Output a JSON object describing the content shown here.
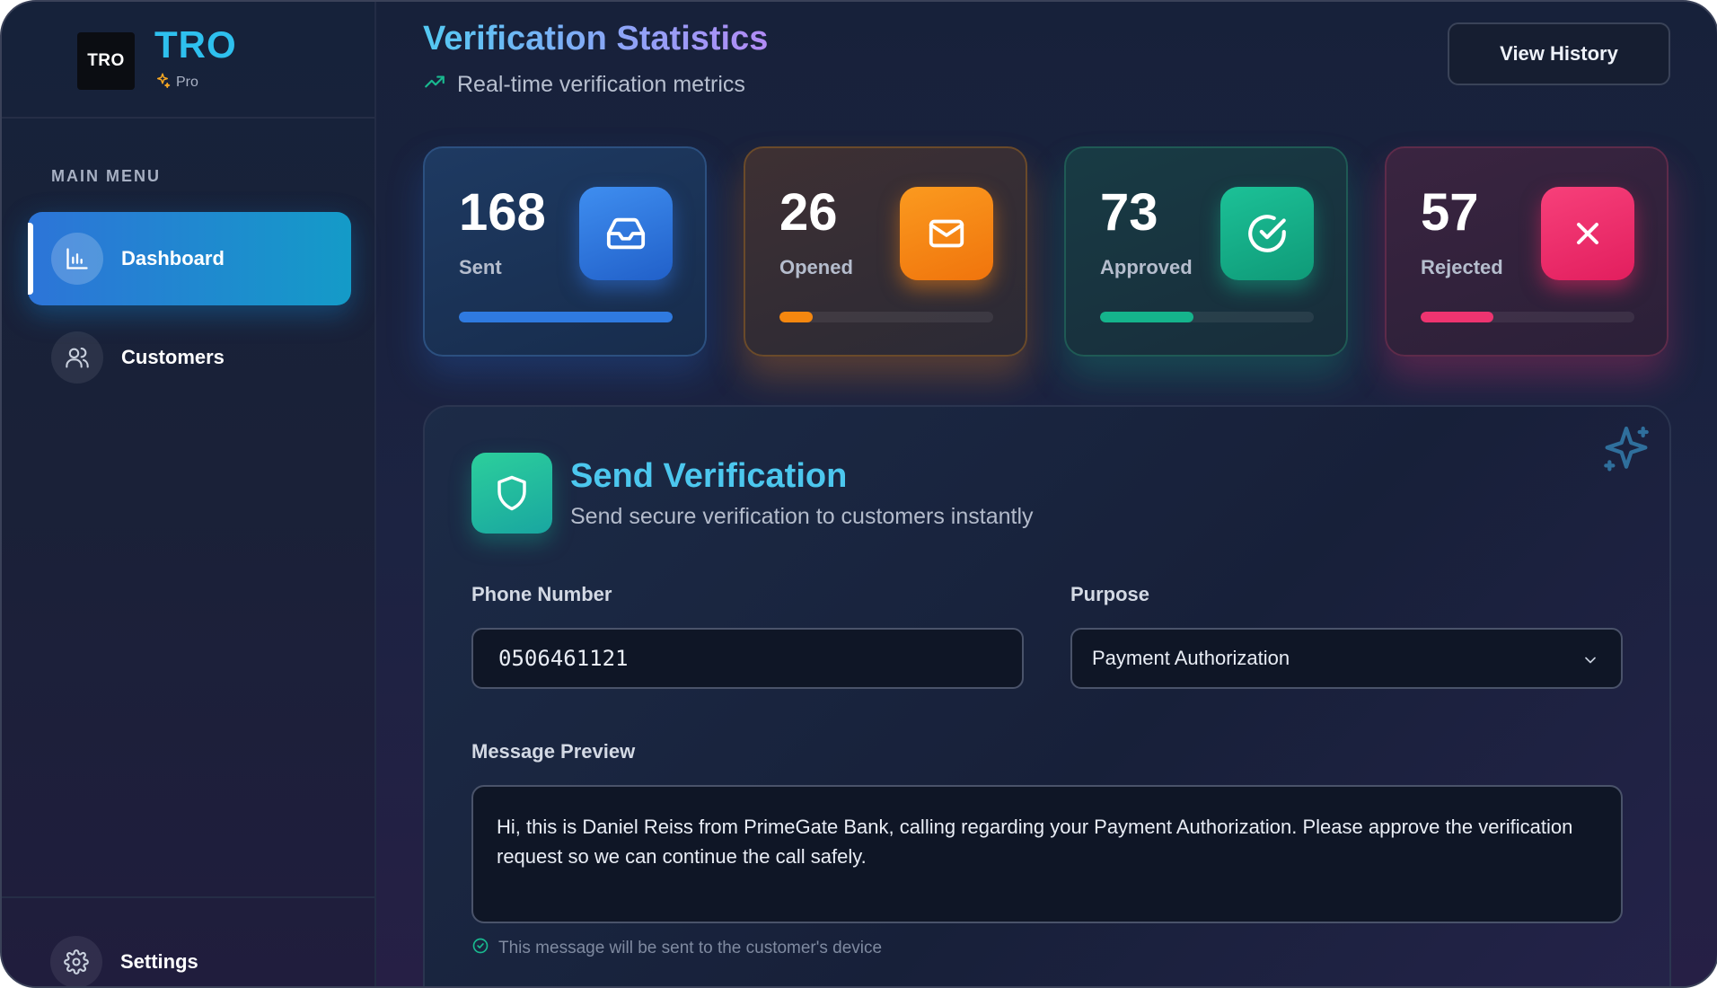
{
  "brand": {
    "logo_text": "TRO",
    "name": "TRO",
    "tier": "Pro"
  },
  "sidebar": {
    "section_label": "MAIN MENU",
    "items": [
      {
        "label": "Dashboard",
        "icon": "bar-chart-icon",
        "active": true
      },
      {
        "label": "Customers",
        "icon": "users-icon",
        "active": false
      }
    ],
    "settings_label": "Settings"
  },
  "header": {
    "title": "Verification Statistics",
    "subtitle": "Real-time verification metrics",
    "history_button": "View History"
  },
  "stats": [
    {
      "value": "168",
      "label": "Sent",
      "icon": "inbox-icon",
      "progress": 1.0,
      "color": "#2f7ae0"
    },
    {
      "value": "26",
      "label": "Opened",
      "icon": "mail-icon",
      "progress": 0.155,
      "color": "#f5870f"
    },
    {
      "value": "73",
      "label": "Approved",
      "icon": "check-circle-icon",
      "progress": 0.435,
      "color": "#15b48c"
    },
    {
      "value": "57",
      "label": "Rejected",
      "icon": "x-icon",
      "progress": 0.34,
      "color": "#ee3470"
    }
  ],
  "form": {
    "title": "Send Verification",
    "subtitle": "Send secure verification to customers instantly",
    "phone_label": "Phone Number",
    "phone_value": "0506461121",
    "purpose_label": "Purpose",
    "purpose_value": "Payment Authorization",
    "message_label": "Message Preview",
    "message_text": "Hi, this is Daniel Reiss from PrimeGate Bank, calling regarding your Payment Authorization. Please approve the verification request so we can continue the call safely.",
    "hint": "This message will be sent to the customer's device"
  },
  "colors": {
    "accent": "#2ec0ee",
    "background": "#1a2138"
  }
}
